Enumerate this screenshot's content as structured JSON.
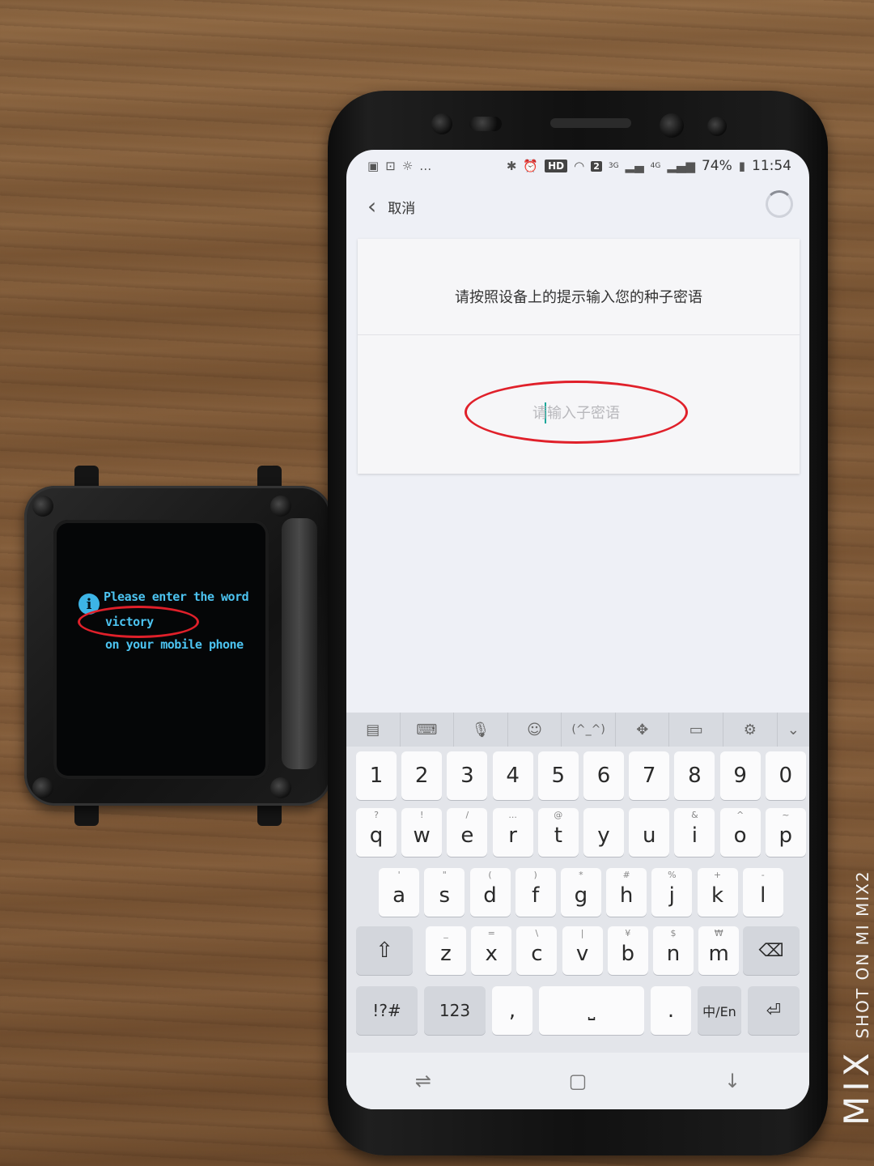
{
  "watch": {
    "line1": "Please enter the word",
    "line2": "victory",
    "line3": "on your mobile phone",
    "info_icon": "info-icon"
  },
  "phone": {
    "status_bar": {
      "left_icons": [
        "image-icon",
        "lock-icon",
        "sun-icon",
        "more-dots-icon"
      ],
      "hd": "HD",
      "sim": "2",
      "net3g": "3G",
      "net4g": "4G",
      "battery": "74%",
      "time": "11:54"
    },
    "header": {
      "cancel_label": "取消"
    },
    "card": {
      "prompt": "请按照设备上的提示输入您的种子密语",
      "input_placeholder": "请输入子密语",
      "input_value": ""
    },
    "keyboard": {
      "toolbar": [
        "clipboard-icon",
        "keyboard-icon",
        "microphone-icon",
        "emoji-icon",
        "(^_^)",
        "move-icon",
        "save-icon",
        "settings-icon",
        "chevron-down-icon"
      ],
      "toolbar_kaomoji": "(^_^)",
      "row_numbers": [
        "1",
        "2",
        "3",
        "4",
        "5",
        "6",
        "7",
        "8",
        "9",
        "0"
      ],
      "row_q": [
        {
          "key": "q",
          "sub": "?"
        },
        {
          "key": "w",
          "sub": "!"
        },
        {
          "key": "e",
          "sub": "/"
        },
        {
          "key": "r",
          "sub": "..."
        },
        {
          "key": "t",
          "sub": "@"
        },
        {
          "key": "y",
          "sub": ""
        },
        {
          "key": "u",
          "sub": ""
        },
        {
          "key": "i",
          "sub": "&"
        },
        {
          "key": "o",
          "sub": "^"
        },
        {
          "key": "p",
          "sub": "~"
        }
      ],
      "row_a": [
        {
          "key": "a",
          "sub": "'"
        },
        {
          "key": "s",
          "sub": "\""
        },
        {
          "key": "d",
          "sub": "("
        },
        {
          "key": "f",
          "sub": ")"
        },
        {
          "key": "g",
          "sub": "*"
        },
        {
          "key": "h",
          "sub": "#"
        },
        {
          "key": "j",
          "sub": "%"
        },
        {
          "key": "k",
          "sub": "+"
        },
        {
          "key": "l",
          "sub": "-"
        }
      ],
      "row_z": [
        {
          "key": "z",
          "sub": "_"
        },
        {
          "key": "x",
          "sub": "="
        },
        {
          "key": "c",
          "sub": "\\"
        },
        {
          "key": "v",
          "sub": "|"
        },
        {
          "key": "b",
          "sub": "¥"
        },
        {
          "key": "n",
          "sub": "$"
        },
        {
          "key": "m",
          "sub": "₩"
        }
      ],
      "shift_icon": "shift-icon",
      "backspace_icon": "backspace-icon",
      "symbols_label": "!?#",
      "numbers_label": "123",
      "comma_label": ",",
      "space_icon": "space-icon",
      "period_label": ".",
      "lang_label": "中/En",
      "enter_icon": "enter-icon"
    },
    "nav_bar": [
      "recents-icon",
      "home-icon",
      "back-icon"
    ]
  },
  "watermark": {
    "brand": "MIX",
    "text": "SHOT ON MI MIX2"
  },
  "colors": {
    "annotation_red": "#e0202a",
    "watch_text": "#4cc3f0",
    "cursor": "#1ba89b"
  }
}
